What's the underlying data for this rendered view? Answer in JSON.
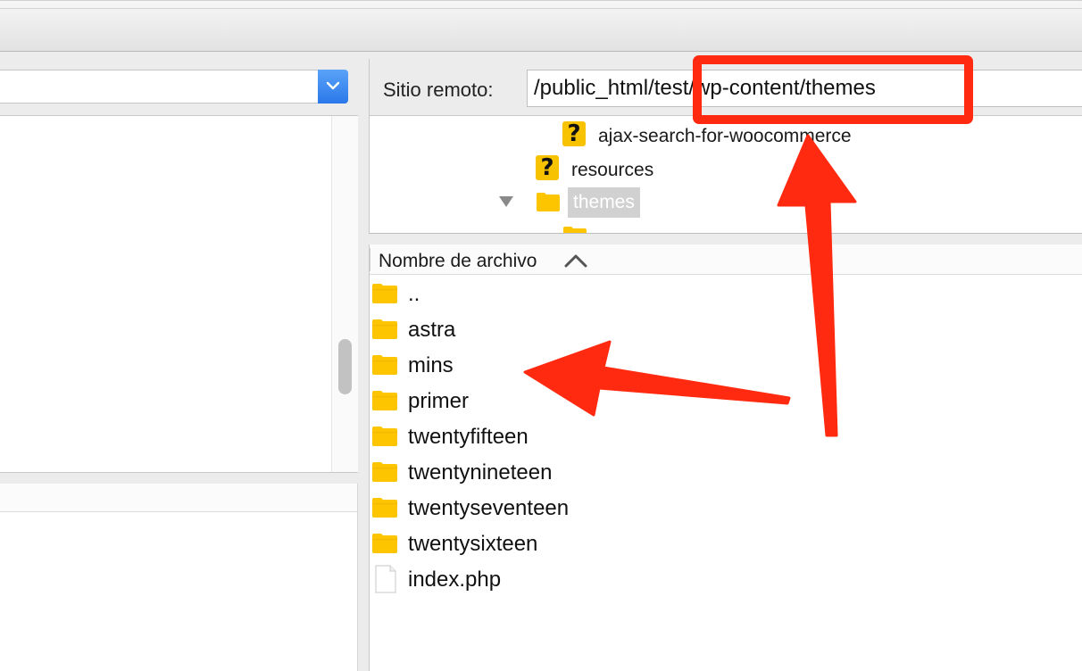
{
  "remote_site": {
    "label": "Sitio remoto:",
    "path": "/public_html/test/wp-content/themes"
  },
  "remote_tree": {
    "items": [
      {
        "name": "ajax-search-for-woocommerce",
        "icon": "unknown-folder-icon"
      },
      {
        "name": "resources",
        "icon": "unknown-folder-icon"
      },
      {
        "name": "themes",
        "icon": "folder-icon",
        "expanded": true,
        "selected": true
      }
    ]
  },
  "remote_list": {
    "column_header": "Nombre de archivo",
    "sort": "ascending",
    "items": [
      {
        "name": "..",
        "type": "folder"
      },
      {
        "name": "astra",
        "type": "folder"
      },
      {
        "name": "mins",
        "type": "folder"
      },
      {
        "name": "primer",
        "type": "folder"
      },
      {
        "name": "twentyfifteen",
        "type": "folder"
      },
      {
        "name": "twentynineteen",
        "type": "folder"
      },
      {
        "name": "twentyseventeen",
        "type": "folder"
      },
      {
        "name": "twentysixteen",
        "type": "folder"
      },
      {
        "name": "index.php",
        "type": "file"
      }
    ]
  },
  "colors": {
    "folder": "#fdc400",
    "annotation": "#ff2a10",
    "combo_button": "#3b89f0",
    "selected_row": "#d1d1d1"
  }
}
